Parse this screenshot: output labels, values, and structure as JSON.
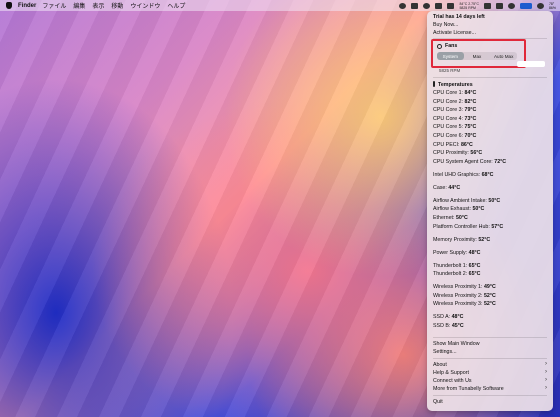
{
  "menubar": {
    "app_name": "Finder",
    "items": [
      "ファイル",
      "編集",
      "表示",
      "移動",
      "ウインドウ",
      "ヘルプ"
    ],
    "sensor_line1": "84°C 2.75°C",
    "sensor_line2": "5825 RPM",
    "clock_line1": "78°",
    "clock_line2": "86%"
  },
  "trial": {
    "title": "Trial has 14 days left",
    "buy": "Buy Now...",
    "activate": "Activate License..."
  },
  "fans": {
    "title": "Fans",
    "modes": [
      "System",
      "Max",
      "Auto Max"
    ],
    "selected_mode": "System",
    "rpm": "5825 RPM"
  },
  "temperatures": {
    "title": "Temperatures",
    "groups": [
      [
        {
          "label": "CPU Core 1:",
          "value": "84°C"
        },
        {
          "label": "CPU Core 2:",
          "value": "82°C"
        },
        {
          "label": "CPU Core 3:",
          "value": "79°C"
        },
        {
          "label": "CPU Core 4:",
          "value": "73°C"
        },
        {
          "label": "CPU Core 5:",
          "value": "75°C"
        },
        {
          "label": "CPU Core 6:",
          "value": "70°C"
        },
        {
          "label": "CPU PECI:",
          "value": "86°C"
        },
        {
          "label": "CPU Proximity:",
          "value": "56°C"
        },
        {
          "label": "CPU System Agent Core:",
          "value": "72°C"
        }
      ],
      [
        {
          "label": "Intel UHD Graphics:",
          "value": "68°C"
        }
      ],
      [
        {
          "label": "Case:",
          "value": "44°C"
        }
      ],
      [
        {
          "label": "Airflow Ambient Intake:",
          "value": "50°C"
        },
        {
          "label": "Airflow Exhaust:",
          "value": "50°C"
        },
        {
          "label": "Ethernet:",
          "value": "50°C"
        },
        {
          "label": "Platform Controller Hub:",
          "value": "57°C"
        }
      ],
      [
        {
          "label": "Memory Proximity:",
          "value": "52°C"
        }
      ],
      [
        {
          "label": "Power Supply:",
          "value": "48°C"
        }
      ],
      [
        {
          "label": "Thunderbolt 1:",
          "value": "65°C"
        },
        {
          "label": "Thunderbolt 2:",
          "value": "65°C"
        }
      ],
      [
        {
          "label": "Wireless Proximity 1:",
          "value": "49°C"
        },
        {
          "label": "Wireless Proximity 2:",
          "value": "52°C"
        },
        {
          "label": "Wireless Proximity 3:",
          "value": "52°C"
        }
      ],
      [
        {
          "label": "SSD A:",
          "value": "48°C"
        },
        {
          "label": "SSD B:",
          "value": "45°C"
        }
      ]
    ]
  },
  "window": {
    "show_main": "Show Main Window",
    "settings": "Settings..."
  },
  "footer": {
    "about": "About",
    "help": "Help & Support",
    "connect": "Connect with Us",
    "more": "More from Tunabelly Software",
    "quit": "Quit"
  },
  "colors": {
    "highlight_border": "#e0283a",
    "selected_segment": "#9aa0a6"
  }
}
